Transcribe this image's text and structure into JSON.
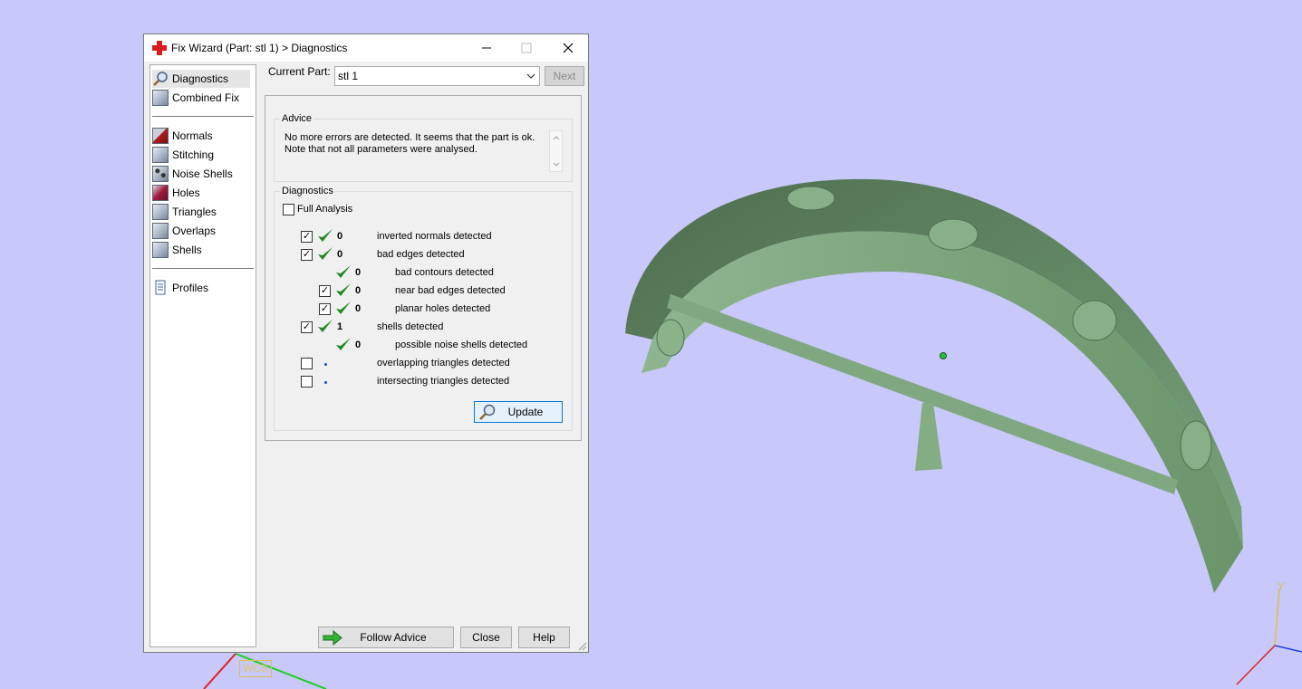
{
  "window": {
    "title": "Fix Wizard (Part: stl 1) > Diagnostics"
  },
  "sidebar": {
    "items": [
      {
        "label": "Diagnostics"
      },
      {
        "label": "Combined Fix"
      },
      {
        "label": "Normals"
      },
      {
        "label": "Stitching"
      },
      {
        "label": "Noise Shells"
      },
      {
        "label": "Holes"
      },
      {
        "label": "Triangles"
      },
      {
        "label": "Overlaps"
      },
      {
        "label": "Shells"
      },
      {
        "label": "Profiles"
      }
    ]
  },
  "current_part": {
    "label": "Current Part:",
    "value": "stl 1",
    "next_label": "Next"
  },
  "advice": {
    "group_label": "Advice",
    "line1": "No more errors are detected. It seems that the part is ok.",
    "line2": "Note that not all parameters were analysed."
  },
  "diagnostics": {
    "group_label": "Diagnostics",
    "full_analysis_label": "Full Analysis",
    "rows": [
      {
        "value": "0",
        "label": "inverted normals detected"
      },
      {
        "value": "0",
        "label": "bad edges detected"
      },
      {
        "value": "0",
        "label": "bad contours detected"
      },
      {
        "value": "0",
        "label": "near bad edges detected"
      },
      {
        "value": "0",
        "label": "planar holes detected"
      },
      {
        "value": "1",
        "label": "shells detected"
      },
      {
        "value": "0",
        "label": "possible noise shells detected"
      },
      {
        "value": "",
        "label": "overlapping triangles detected"
      },
      {
        "value": "",
        "label": "intersecting triangles detected"
      }
    ],
    "update_label": "Update"
  },
  "footer": {
    "follow_advice_label": "Follow Advice",
    "close_label": "Close",
    "help_label": "Help"
  },
  "viewport": {
    "wcs_label": "WCS",
    "y_axis_label": "Y",
    "part_color": "#6e9670"
  }
}
